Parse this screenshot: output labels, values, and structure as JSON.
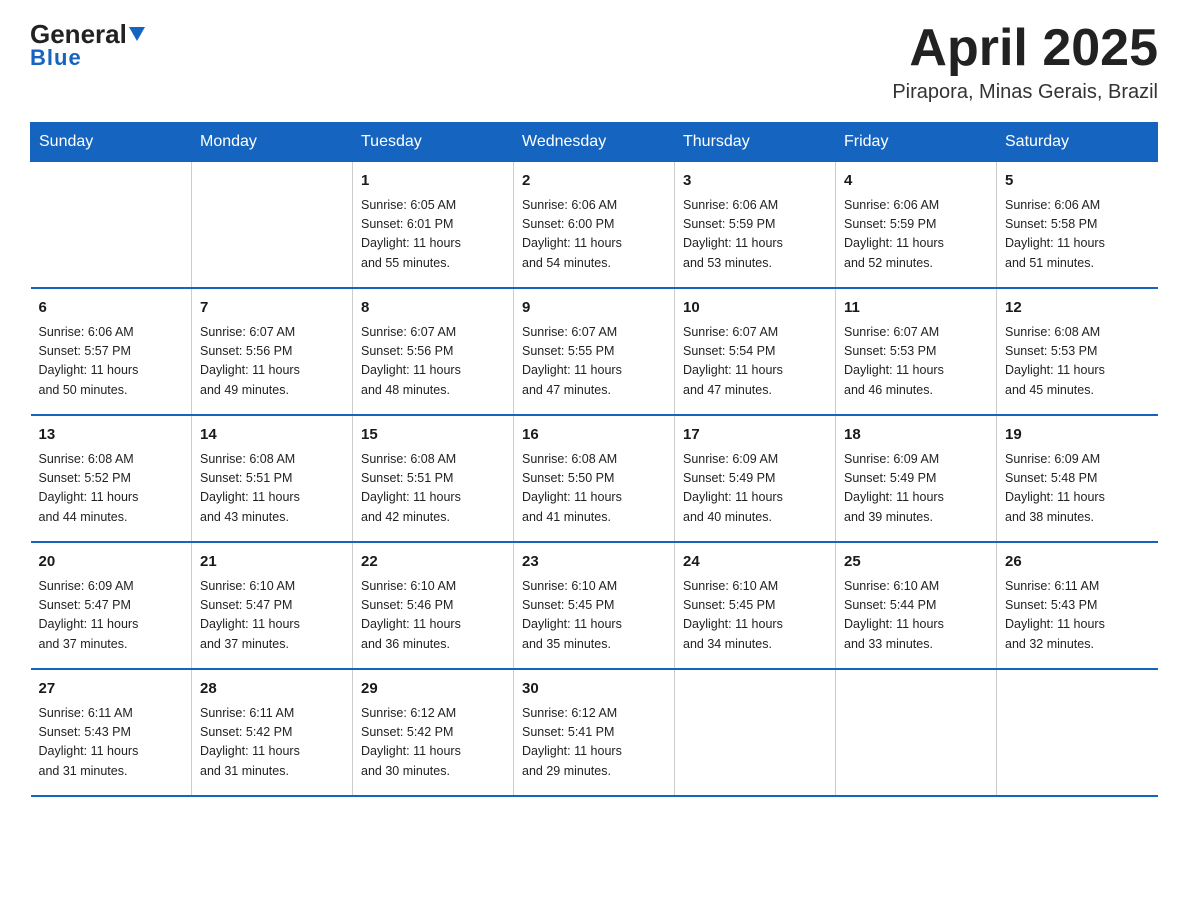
{
  "header": {
    "logo_general": "General",
    "logo_blue": "Blue",
    "month_title": "April 2025",
    "location": "Pirapora, Minas Gerais, Brazil"
  },
  "days_of_week": [
    "Sunday",
    "Monday",
    "Tuesday",
    "Wednesday",
    "Thursday",
    "Friday",
    "Saturday"
  ],
  "weeks": [
    [
      {
        "day": "",
        "info": ""
      },
      {
        "day": "",
        "info": ""
      },
      {
        "day": "1",
        "info": "Sunrise: 6:05 AM\nSunset: 6:01 PM\nDaylight: 11 hours\nand 55 minutes."
      },
      {
        "day": "2",
        "info": "Sunrise: 6:06 AM\nSunset: 6:00 PM\nDaylight: 11 hours\nand 54 minutes."
      },
      {
        "day": "3",
        "info": "Sunrise: 6:06 AM\nSunset: 5:59 PM\nDaylight: 11 hours\nand 53 minutes."
      },
      {
        "day": "4",
        "info": "Sunrise: 6:06 AM\nSunset: 5:59 PM\nDaylight: 11 hours\nand 52 minutes."
      },
      {
        "day": "5",
        "info": "Sunrise: 6:06 AM\nSunset: 5:58 PM\nDaylight: 11 hours\nand 51 minutes."
      }
    ],
    [
      {
        "day": "6",
        "info": "Sunrise: 6:06 AM\nSunset: 5:57 PM\nDaylight: 11 hours\nand 50 minutes."
      },
      {
        "day": "7",
        "info": "Sunrise: 6:07 AM\nSunset: 5:56 PM\nDaylight: 11 hours\nand 49 minutes."
      },
      {
        "day": "8",
        "info": "Sunrise: 6:07 AM\nSunset: 5:56 PM\nDaylight: 11 hours\nand 48 minutes."
      },
      {
        "day": "9",
        "info": "Sunrise: 6:07 AM\nSunset: 5:55 PM\nDaylight: 11 hours\nand 47 minutes."
      },
      {
        "day": "10",
        "info": "Sunrise: 6:07 AM\nSunset: 5:54 PM\nDaylight: 11 hours\nand 47 minutes."
      },
      {
        "day": "11",
        "info": "Sunrise: 6:07 AM\nSunset: 5:53 PM\nDaylight: 11 hours\nand 46 minutes."
      },
      {
        "day": "12",
        "info": "Sunrise: 6:08 AM\nSunset: 5:53 PM\nDaylight: 11 hours\nand 45 minutes."
      }
    ],
    [
      {
        "day": "13",
        "info": "Sunrise: 6:08 AM\nSunset: 5:52 PM\nDaylight: 11 hours\nand 44 minutes."
      },
      {
        "day": "14",
        "info": "Sunrise: 6:08 AM\nSunset: 5:51 PM\nDaylight: 11 hours\nand 43 minutes."
      },
      {
        "day": "15",
        "info": "Sunrise: 6:08 AM\nSunset: 5:51 PM\nDaylight: 11 hours\nand 42 minutes."
      },
      {
        "day": "16",
        "info": "Sunrise: 6:08 AM\nSunset: 5:50 PM\nDaylight: 11 hours\nand 41 minutes."
      },
      {
        "day": "17",
        "info": "Sunrise: 6:09 AM\nSunset: 5:49 PM\nDaylight: 11 hours\nand 40 minutes."
      },
      {
        "day": "18",
        "info": "Sunrise: 6:09 AM\nSunset: 5:49 PM\nDaylight: 11 hours\nand 39 minutes."
      },
      {
        "day": "19",
        "info": "Sunrise: 6:09 AM\nSunset: 5:48 PM\nDaylight: 11 hours\nand 38 minutes."
      }
    ],
    [
      {
        "day": "20",
        "info": "Sunrise: 6:09 AM\nSunset: 5:47 PM\nDaylight: 11 hours\nand 37 minutes."
      },
      {
        "day": "21",
        "info": "Sunrise: 6:10 AM\nSunset: 5:47 PM\nDaylight: 11 hours\nand 37 minutes."
      },
      {
        "day": "22",
        "info": "Sunrise: 6:10 AM\nSunset: 5:46 PM\nDaylight: 11 hours\nand 36 minutes."
      },
      {
        "day": "23",
        "info": "Sunrise: 6:10 AM\nSunset: 5:45 PM\nDaylight: 11 hours\nand 35 minutes."
      },
      {
        "day": "24",
        "info": "Sunrise: 6:10 AM\nSunset: 5:45 PM\nDaylight: 11 hours\nand 34 minutes."
      },
      {
        "day": "25",
        "info": "Sunrise: 6:10 AM\nSunset: 5:44 PM\nDaylight: 11 hours\nand 33 minutes."
      },
      {
        "day": "26",
        "info": "Sunrise: 6:11 AM\nSunset: 5:43 PM\nDaylight: 11 hours\nand 32 minutes."
      }
    ],
    [
      {
        "day": "27",
        "info": "Sunrise: 6:11 AM\nSunset: 5:43 PM\nDaylight: 11 hours\nand 31 minutes."
      },
      {
        "day": "28",
        "info": "Sunrise: 6:11 AM\nSunset: 5:42 PM\nDaylight: 11 hours\nand 31 minutes."
      },
      {
        "day": "29",
        "info": "Sunrise: 6:12 AM\nSunset: 5:42 PM\nDaylight: 11 hours\nand 30 minutes."
      },
      {
        "day": "30",
        "info": "Sunrise: 6:12 AM\nSunset: 5:41 PM\nDaylight: 11 hours\nand 29 minutes."
      },
      {
        "day": "",
        "info": ""
      },
      {
        "day": "",
        "info": ""
      },
      {
        "day": "",
        "info": ""
      }
    ]
  ]
}
